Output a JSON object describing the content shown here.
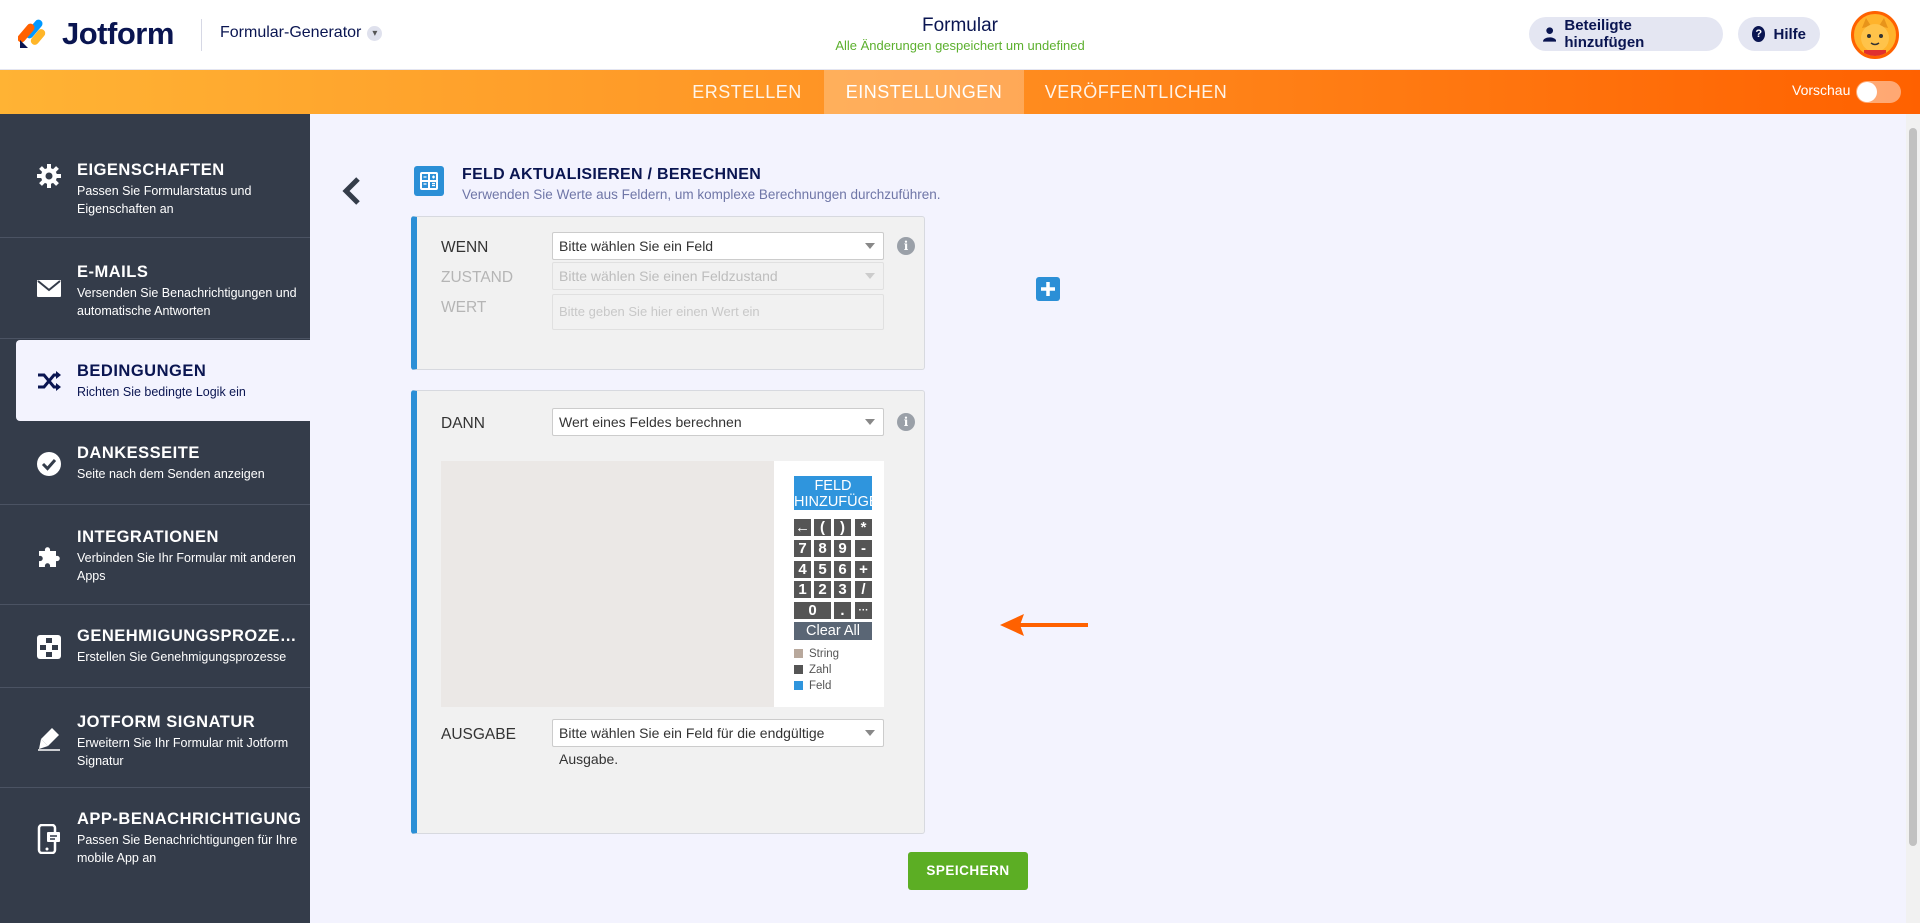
{
  "header": {
    "brand": "Jotform",
    "builder_label": "Formular-Generator",
    "form_title": "Formular",
    "save_status": "Alle Änderungen gespeichert um undefined",
    "add_participants": "Beteiligte hinzufügen",
    "help": "Hilfe"
  },
  "nav": {
    "tabs": [
      "ERSTELLEN",
      "EINSTELLUNGEN",
      "VERÖFFENTLICHEN"
    ],
    "active_tab": "EINSTELLUNGEN",
    "preview_label": "Vorschau",
    "preview_on": false
  },
  "sidebar": {
    "items": [
      {
        "title": "EIGENSCHAFTEN",
        "desc": "Passen Sie Formularstatus und Eigenschaften an",
        "icon": "gear-icon"
      },
      {
        "title": "E-MAILS",
        "desc": "Versenden Sie Benachrichtigungen und automatische Antworten",
        "icon": "envelope-icon"
      },
      {
        "title": "BEDINGUNGEN",
        "desc": "Richten Sie bedingte Logik ein",
        "icon": "shuffle-icon"
      },
      {
        "title": "DANKESSEITE",
        "desc": "Seite nach dem Senden anzeigen",
        "icon": "check-circle-icon"
      },
      {
        "title": "INTEGRATIONEN",
        "desc": "Verbinden Sie Ihr Formular mit anderen Apps",
        "icon": "puzzle-icon"
      },
      {
        "title": "GENEHMIGUNGSPROZESSE",
        "desc": "Erstellen Sie Genehmigungsprozesse",
        "icon": "flow-icon"
      },
      {
        "title": "JOTFORM SIGNATUR",
        "desc": "Erweitern Sie Ihr Formular mit Jotform Signatur",
        "icon": "pen-icon"
      },
      {
        "title": "APP-BENACHRICHTIGUNG",
        "desc": "Passen Sie Benachrichtigungen für Ihre mobile App an",
        "icon": "phone-icon"
      }
    ],
    "active_index": 2
  },
  "section": {
    "title": "FELD AKTUALISIEREN / BERECHNEN",
    "subtitle": "Verwenden Sie Werte aus Feldern, um komplexe Berechnungen durchzuführen."
  },
  "if_block": {
    "if_label": "WENN",
    "if_select": "Bitte wählen Sie ein Feld",
    "state_label": "ZUSTAND",
    "state_select": "Bitte wählen Sie einen Feldzustand",
    "value_label": "WERT",
    "value_placeholder": "Bitte geben Sie hier einen Wert ein"
  },
  "then_block": {
    "then_label": "DANN",
    "then_select": "Wert eines Feldes berechnen",
    "add_field_line1": "FELD",
    "add_field_line2": "HINZUFÜGEN",
    "keypad": [
      [
        "←",
        "(",
        ")",
        "*"
      ],
      [
        "7",
        "8",
        "9",
        "-"
      ],
      [
        "4",
        "5",
        "6",
        "+"
      ],
      [
        "1",
        "2",
        "3",
        "/"
      ],
      [
        "0",
        ".",
        "···"
      ]
    ],
    "clear_all": "Clear All",
    "legend": [
      {
        "label": "String",
        "color": "#b8a89c"
      },
      {
        "label": "Zahl",
        "color": "#555555"
      },
      {
        "label": "Feld",
        "color": "#2f95dd"
      }
    ],
    "output_label": "AUSGABE",
    "output_select": "Bitte wählen Sie ein Feld für die endgültige Ausgabe."
  },
  "save_button": "SPEICHERN",
  "colors": {
    "accent_blue": "#2b8fd6",
    "nav_orange": "#ff6100",
    "save_green": "#5cae24",
    "sidebar_bg": "#343c4a"
  }
}
